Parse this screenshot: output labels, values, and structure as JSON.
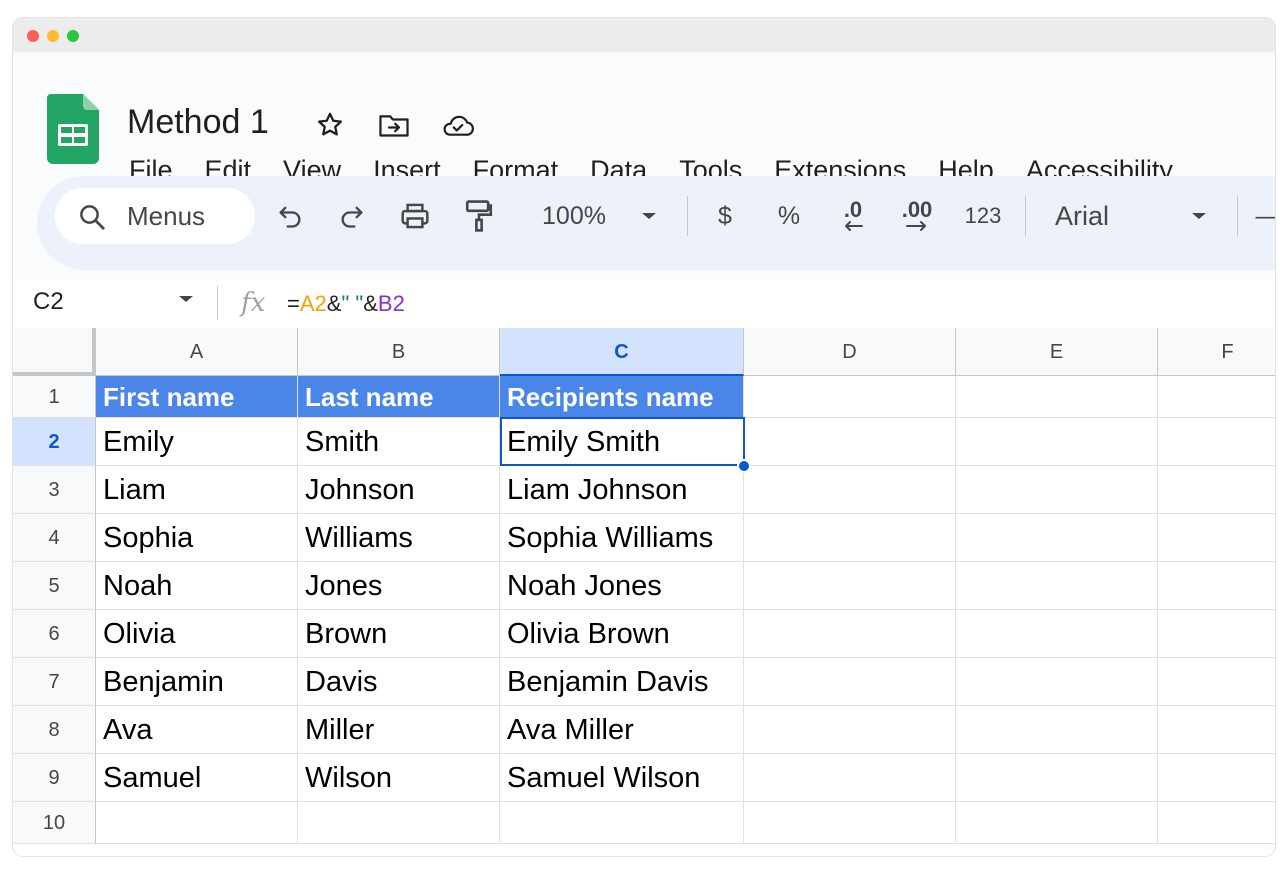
{
  "doc": {
    "title": "Method 1"
  },
  "menu": [
    "File",
    "Edit",
    "View",
    "Insert",
    "Format",
    "Data",
    "Tools",
    "Extensions",
    "Help",
    "Accessibility"
  ],
  "toolbar": {
    "search_label": "Menus",
    "zoom": "100%",
    "currency": "$",
    "percent": "%",
    "decrease_decimal": ".0",
    "increase_decimal": ".00",
    "number_format": "123",
    "font": "Arial",
    "font_size_decrease": "—"
  },
  "formula_bar": {
    "cell_ref": "C2",
    "fx": "fx",
    "formula_eq": "=",
    "formula_ref_a": "A2",
    "formula_amp1": "&",
    "formula_string": "\" \"",
    "formula_amp2": "&",
    "formula_ref_b": "B2"
  },
  "grid": {
    "columns": [
      "A",
      "B",
      "C",
      "D",
      "E",
      "F"
    ],
    "selected_column": "C",
    "rows": [
      "1",
      "2",
      "3",
      "4",
      "5",
      "6",
      "7",
      "8",
      "9",
      "10"
    ],
    "selected_row": "2",
    "header": [
      "First name",
      "Last name",
      "Recipients name"
    ],
    "data": [
      [
        "Emily",
        "Smith",
        "Emily Smith"
      ],
      [
        "Liam",
        "Johnson",
        "Liam Johnson"
      ],
      [
        "Sophia",
        "Williams",
        "Sophia Williams"
      ],
      [
        "Noah",
        "Jones",
        "Noah Jones"
      ],
      [
        "Olivia",
        "Brown",
        "Olivia Brown"
      ],
      [
        "Benjamin",
        "Davis",
        "Benjamin Davis"
      ],
      [
        "Ava",
        "Miller",
        "Ava Miller"
      ],
      [
        "Samuel",
        "Wilson",
        "Samuel Wilson"
      ]
    ]
  },
  "colors": {
    "header_fill": "#4a86e8",
    "selection": "#0b57d0",
    "logo_green": "#23a566"
  }
}
